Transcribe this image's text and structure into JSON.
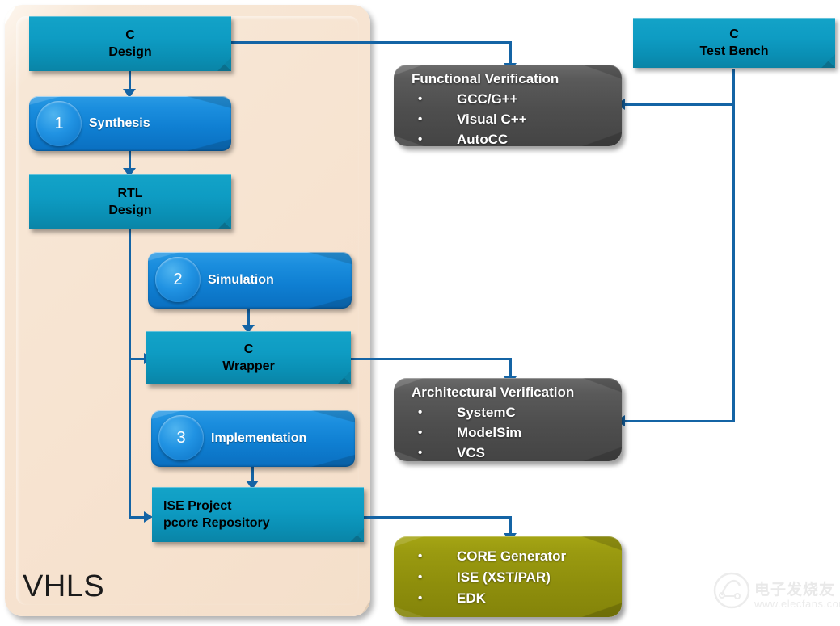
{
  "container": {
    "label": "VHLS"
  },
  "flow_boxes": {
    "c_design": {
      "line1": "C",
      "line2": "Design"
    },
    "rtl_design": {
      "line1": "RTL",
      "line2": "Design"
    },
    "c_wrapper": {
      "line1": "C",
      "line2": "Wrapper"
    },
    "ise_project": {
      "line1": "ISE Project",
      "line2": "pcore Repository"
    },
    "c_test_bench": {
      "line1": "C",
      "line2": "Test Bench"
    }
  },
  "steps": [
    {
      "number": "1",
      "label": "Synthesis"
    },
    {
      "number": "2",
      "label": "Simulation"
    },
    {
      "number": "3",
      "label": "Implementation"
    }
  ],
  "functional_verification": {
    "title": "Functional Verification",
    "items": [
      "GCC/G++",
      "Visual C++",
      "AutoCC"
    ]
  },
  "architectural_verification": {
    "title": "Architectural Verification",
    "items": [
      "SystemC",
      "ModelSim",
      "VCS"
    ]
  },
  "implementation_tools": {
    "items": [
      "CORE Generator",
      "ISE (XST/PAR)",
      "EDK"
    ]
  },
  "watermark": {
    "text": "电子发烧友",
    "url": "www.elecfans.com"
  },
  "colors": {
    "container_bg": "#f7e3d0",
    "teal": "#0e9cc3",
    "blue_step": "#1b8ede",
    "gray": "#4e4e4e",
    "olive": "#8e8e0c",
    "connector": "#1464a5"
  }
}
